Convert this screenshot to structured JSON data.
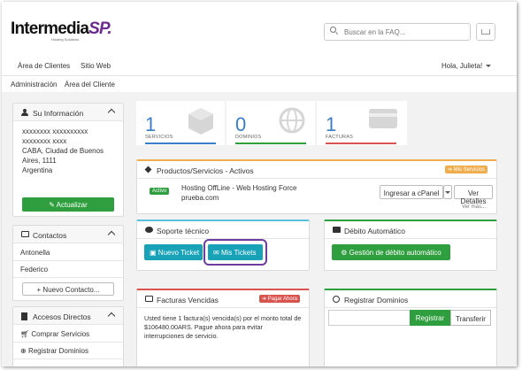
{
  "brand": {
    "name_main": "Intermedia",
    "name_accent": "SP.",
    "tagline": "Hosting Solutions"
  },
  "search": {
    "placeholder": "Buscar en la FAQ..."
  },
  "nav": {
    "items": [
      {
        "label": "Área de Clientes"
      },
      {
        "label": "Sitio Web"
      }
    ],
    "greeting": "Hola, Julieta!"
  },
  "breadcrumb": {
    "items": [
      {
        "label": "Administración"
      },
      {
        "label": "Área del Cliente"
      }
    ]
  },
  "sidebar": {
    "info": {
      "title": "Su Información",
      "lines": [
        "xxxxxxxx xxxxxxxxxx",
        "xxxxxxxx xxxx",
        "CABA, Ciudad de Buenos",
        "Aires, 1111",
        "Argentina"
      ],
      "update_button": "Actualizar"
    },
    "contacts": {
      "title": "Contactos",
      "items": [
        {
          "label": "Antonella"
        },
        {
          "label": "Federico"
        }
      ],
      "new_button": "Nuevo Contacto..."
    },
    "shortcuts": {
      "title": "Accesos Directos",
      "items": [
        {
          "label": "Comprar Servicios"
        },
        {
          "label": "Registrar Dominios"
        }
      ]
    }
  },
  "stats": [
    {
      "value": "1",
      "label": "SERVICIOS",
      "color": "#3a7dc9"
    },
    {
      "value": "0",
      "label": "DOMINIOS",
      "color": "#2e9e3e"
    },
    {
      "value": "1",
      "label": "FACTURAS",
      "color": "#d9534f"
    }
  ],
  "products": {
    "title": "Productos/Servicios - Activos",
    "badge": "Mis Servicios",
    "item": {
      "status": "Activo",
      "name": "Hosting OffLine - Web Hosting Force",
      "domain": "prueba.com",
      "cpanel_button": "Ingresar a cPanel",
      "details_button": "Ver Detalles"
    },
    "more_link": "Ver más..."
  },
  "support": {
    "title": "Soporte técnico",
    "new_ticket": "Nuevo Ticket",
    "my_tickets": "Mis Tickets"
  },
  "debit": {
    "title": "Débito Automático",
    "button": "Gestión de débito automático"
  },
  "invoices": {
    "title": "Facturas Vencidas",
    "badge": "Pagar Ahora",
    "text": "Usted tiene 1 factura(s) vencida(s) por el monto total de $106480.00ARS. Pague ahora para evitar interrupciones de servicio."
  },
  "domains": {
    "title": "Registrar Dominios",
    "register_button": "Registrar",
    "transfer_button": "Transferir"
  },
  "colors": {
    "accent_purple": "#6a3d9e",
    "green": "#2e9e3e",
    "teal": "#17a2b8",
    "orange": "#f0ad4e",
    "red": "#d9534f",
    "blue": "#3a7dc9"
  }
}
